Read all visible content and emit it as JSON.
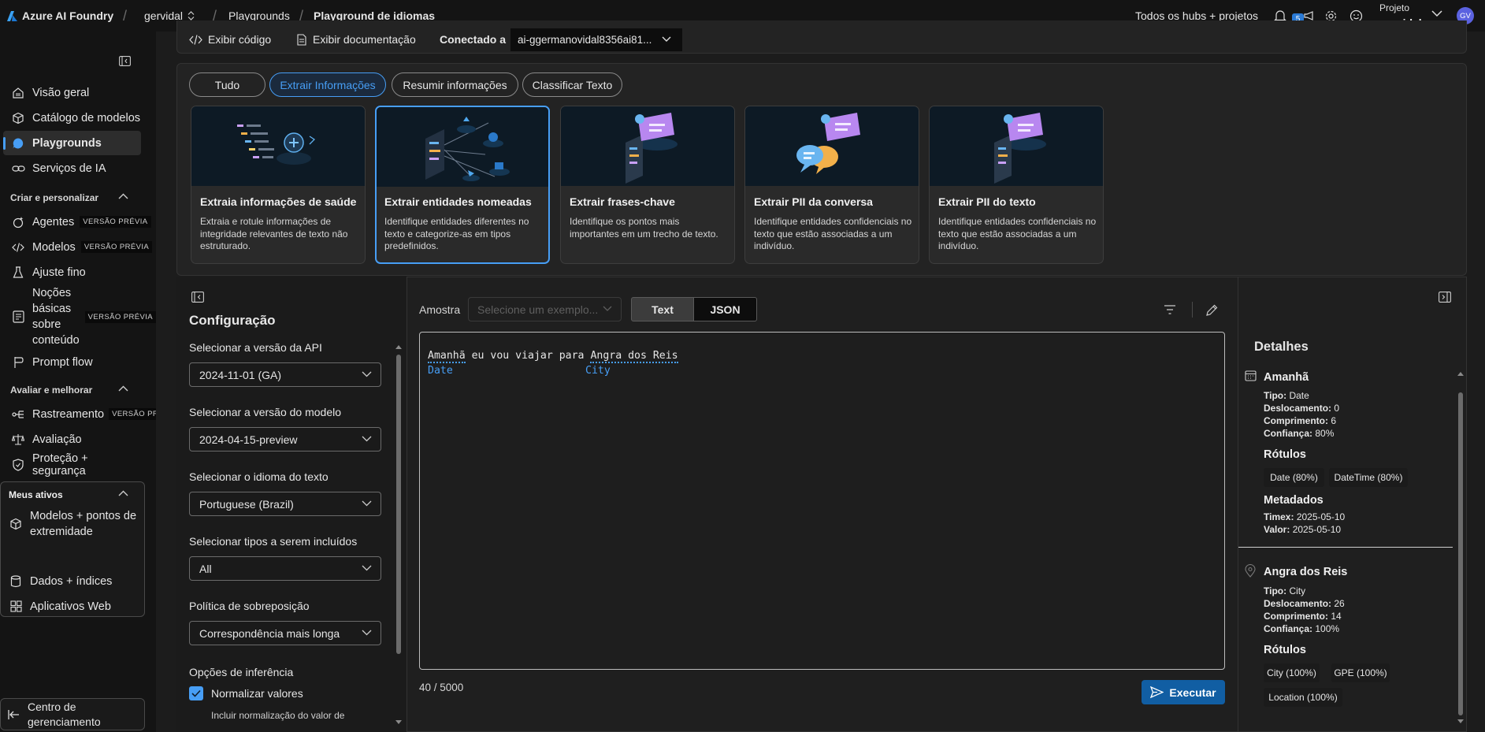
{
  "topbar": {
    "brand": "Azure AI Foundry",
    "hub": "gervidal",
    "crumb1": "Playgrounds",
    "crumb2": "Playground de idiomas",
    "scope": "Todos os hubs + projetos",
    "notif_count": "5",
    "project_label": "Projeto",
    "project_name": "gervidal",
    "avatar": "GV"
  },
  "sidebar": {
    "items": [
      {
        "label": "Visão geral",
        "icon": "home-icon"
      },
      {
        "label": "Catálogo de modelos",
        "icon": "cube-icon"
      },
      {
        "label": "Playgrounds",
        "icon": "chat-icon"
      },
      {
        "label": "Serviços de IA",
        "icon": "link-icon"
      }
    ],
    "section1": "Criar e personalizar",
    "create": [
      {
        "label": "Agentes",
        "badge": "VERSÃO PRÉVIA"
      },
      {
        "label": "Modelos",
        "badge": "VERSÃO PRÉVIA"
      },
      {
        "label": "Ajuste fino"
      },
      {
        "label": "Noções básicas sobre conteúdo",
        "badge": "VERSÃO PRÉVIA"
      },
      {
        "label": "Prompt flow"
      }
    ],
    "section2": "Avaliar e melhorar",
    "evaluate": [
      {
        "label": "Rastreamento",
        "badge": "VERSÃO PRÉ"
      },
      {
        "label": "Avaliação"
      },
      {
        "label": "Proteção + segurança"
      }
    ],
    "section3": "Meus ativos",
    "assets": [
      {
        "label": "Modelos + pontos de extremidade"
      },
      {
        "label": "Dados + índices"
      },
      {
        "label": "Aplicativos Web"
      }
    ],
    "management": "Centro de gerenciamento"
  },
  "toolbar": {
    "view_code": "Exibir código",
    "view_docs": "Exibir documentação",
    "connected": "Conectado a",
    "resource": "ai-ggermanovidal8356ai81..."
  },
  "filters": [
    "Tudo",
    "Extrair Informações",
    "Resumir informações",
    "Classificar Texto"
  ],
  "cards": [
    {
      "title": "Extraia informações de saúde",
      "desc": "Extraia e rotule informações de integridade relevantes de texto não estruturado."
    },
    {
      "title": "Extrair entidades nomeadas",
      "desc": "Identifique entidades diferentes no texto e categorize-as em tipos predefinidos."
    },
    {
      "title": "Extrair frases-chave",
      "desc": "Identifique os pontos mais importantes em um trecho de texto."
    },
    {
      "title": "Extrair PII da conversa",
      "desc": "Identifique entidades confidenciais no texto que estão associadas a um indivíduo."
    },
    {
      "title": "Extrair PII do texto",
      "desc": "Identifique entidades confidenciais no texto que estão associadas a um indivíduo."
    }
  ],
  "config": {
    "title": "Configuração",
    "api_label": "Selecionar a versão da API",
    "api_value": "2024-11-01 (GA)",
    "model_label": "Selecionar a versão do modelo",
    "model_value": "2024-04-15-preview",
    "lang_label": "Selecionar o idioma do texto",
    "lang_value": "Portuguese (Brazil)",
    "types_label": "Selecionar tipos a serem incluídos",
    "types_value": "All",
    "overlap_label": "Política de sobreposição",
    "overlap_value": "Correspondência mais longa",
    "inference_label": "Opções de inferência",
    "normalize_label": "Normalizar valores",
    "normalize_desc": "Incluir normalização do valor de"
  },
  "editor": {
    "sample_label": "Amostra",
    "sample_placeholder": "Selecione um exemplo...",
    "tab_text": "Text",
    "tab_json": "JSON",
    "t1": "Amanhã",
    "t2": " eu vou viajar para ",
    "t3": "Angra dos Reis",
    "label1": "Date",
    "label2": "City",
    "counter": "40 / 5000",
    "run": "Executar"
  },
  "details": {
    "title": "Detalhes",
    "e1": {
      "name": "Amanhã",
      "tipo_k": "Tipo:",
      "tipo": "Date",
      "desl_k": "Deslocamento:",
      "desl": "0",
      "comp_k": "Comprimento:",
      "comp": "6",
      "conf_k": "Confiança:",
      "conf": "80%",
      "labels_title": "Rótulos",
      "tags": [
        "Date (80%)",
        "DateTime (80%)"
      ],
      "meta_title": "Metadados",
      "timex_k": "Timex:",
      "timex": "2025-05-10",
      "valor_k": "Valor:",
      "valor": "2025-05-10"
    },
    "e2": {
      "name": "Angra dos Reis",
      "tipo_k": "Tipo:",
      "tipo": "City",
      "desl_k": "Deslocamento:",
      "desl": "26",
      "comp_k": "Comprimento:",
      "comp": "14",
      "conf_k": "Confiança:",
      "conf": "100%",
      "labels_title": "Rótulos",
      "tags": [
        "City (100%)",
        "GPE (100%)",
        "Location (100%)"
      ]
    }
  },
  "colors": {
    "accent": "#479ef5",
    "primary_button": "#115ea3"
  }
}
